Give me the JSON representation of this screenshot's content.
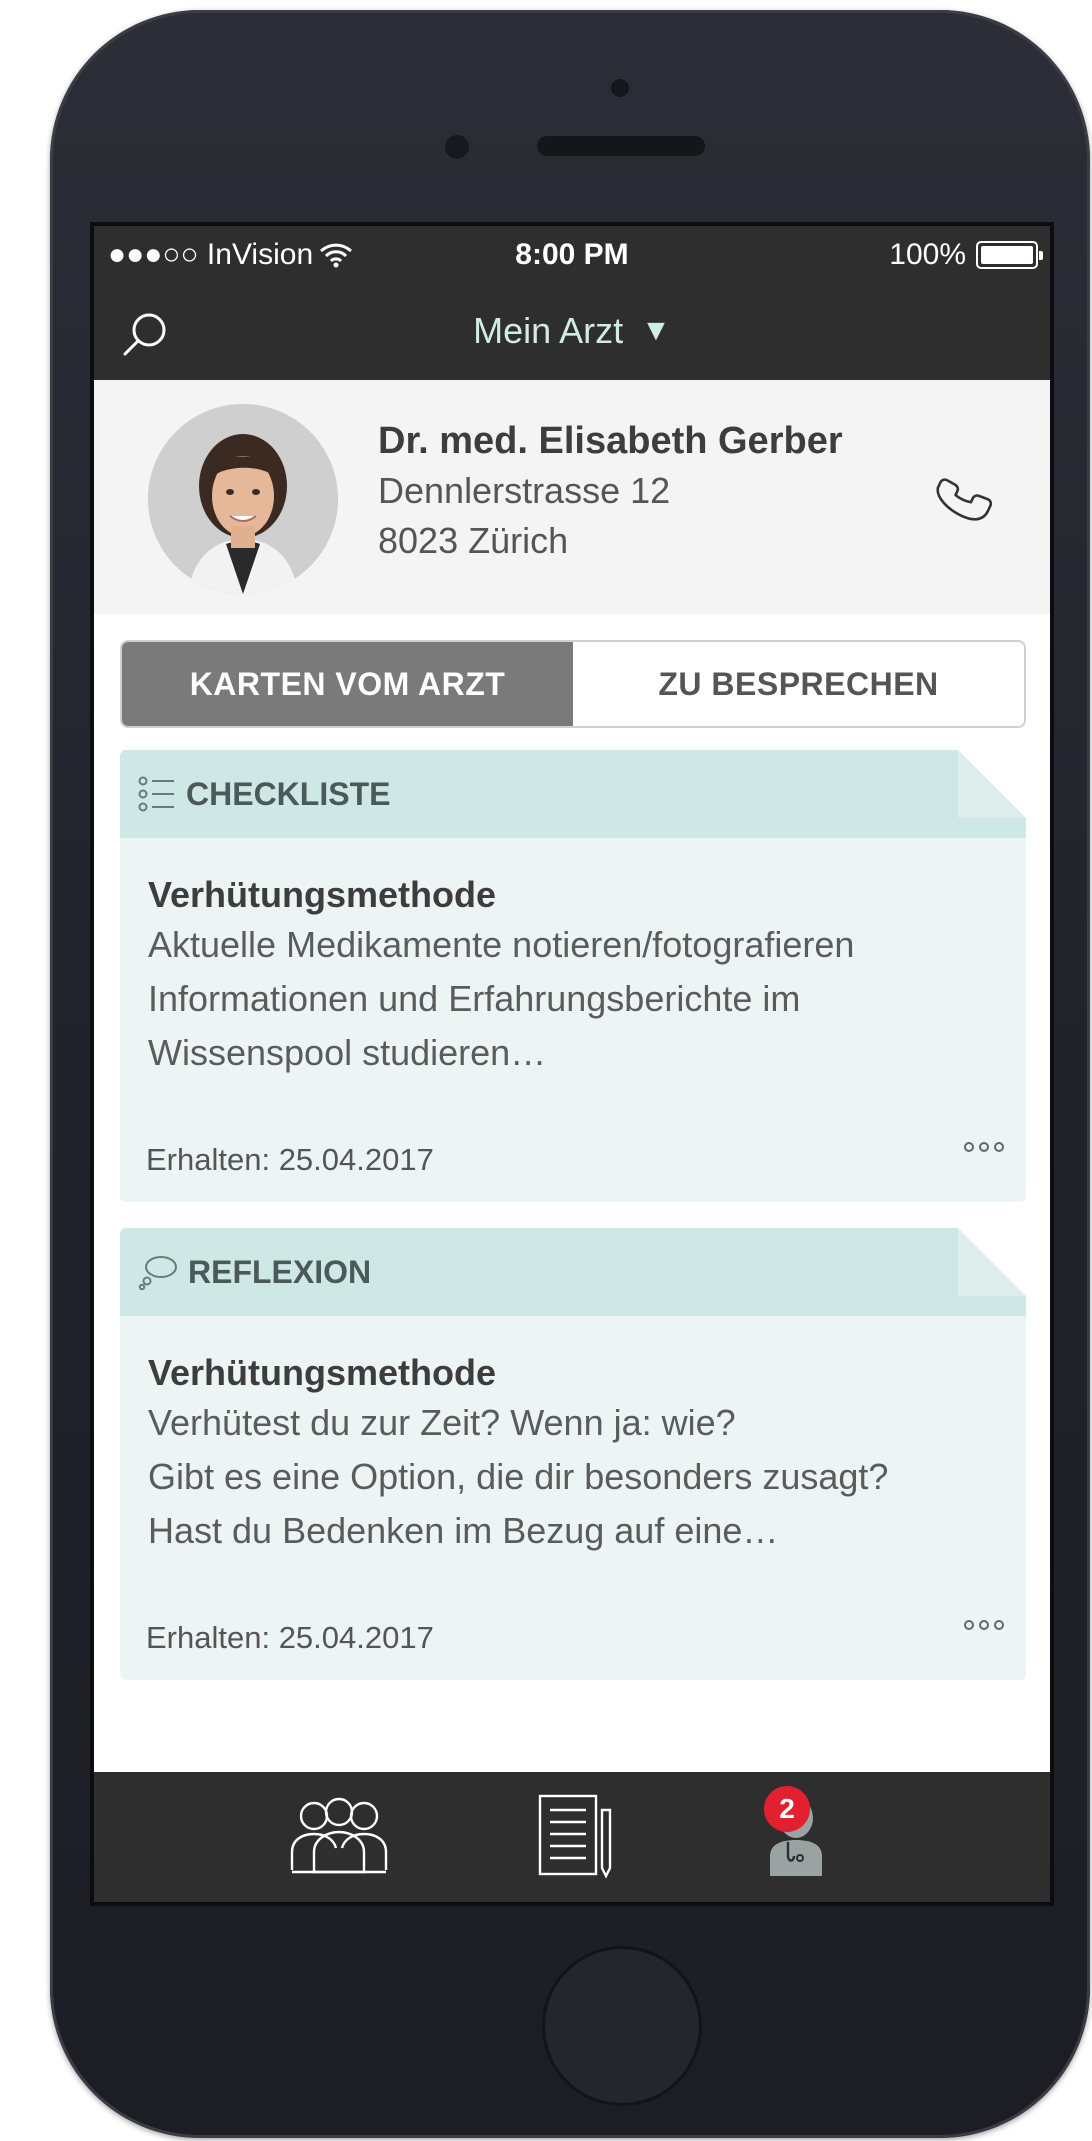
{
  "status_bar": {
    "carrier": "●●●○○ InVision",
    "time": "8:00 PM",
    "battery": "100%"
  },
  "nav": {
    "title": "Mein Arzt",
    "caret": "▼",
    "search_icon": "search-icon"
  },
  "doctor": {
    "name": "Dr. med. Elisabeth Gerber",
    "street": "Dennlerstrasse 12",
    "city": "8023 Zürich",
    "phone_icon": "phone-icon"
  },
  "tabs": [
    {
      "label": "KARTEN VOM ARZT",
      "active": true
    },
    {
      "label": "ZU BESPRECHEN",
      "active": false
    }
  ],
  "cards": [
    {
      "type": "CHECKLISTE",
      "icon": "checklist-icon",
      "title": "Verhütungsmethode",
      "lines": [
        "Aktuelle Medikamente notieren/fotografieren",
        "Informationen und Erfahrungsberichte im",
        "Wissenspool studieren…"
      ],
      "received": "Erhalten: 25.04.2017"
    },
    {
      "type": "REFLEXION",
      "icon": "thought-bubble-icon",
      "title": "Verhütungsmethode",
      "lines": [
        "Verhütest du zur Zeit? Wenn ja: wie?",
        "Gibt es eine Option, die dir besonders zusagt?",
        "Hast du Bedenken im Bezug auf eine…"
      ],
      "received": "Erhalten: 25.04.2017"
    }
  ],
  "tabbar": {
    "items": [
      "community-icon",
      "notes-icon",
      "doctor-icon"
    ],
    "badge": "2"
  },
  "colors": {
    "bar": "#2e2e2e",
    "card_bg": "#ecf5f4",
    "card_head": "#d0e8e5",
    "badge": "#e3202f",
    "active_tab": "#7a7a7a"
  }
}
